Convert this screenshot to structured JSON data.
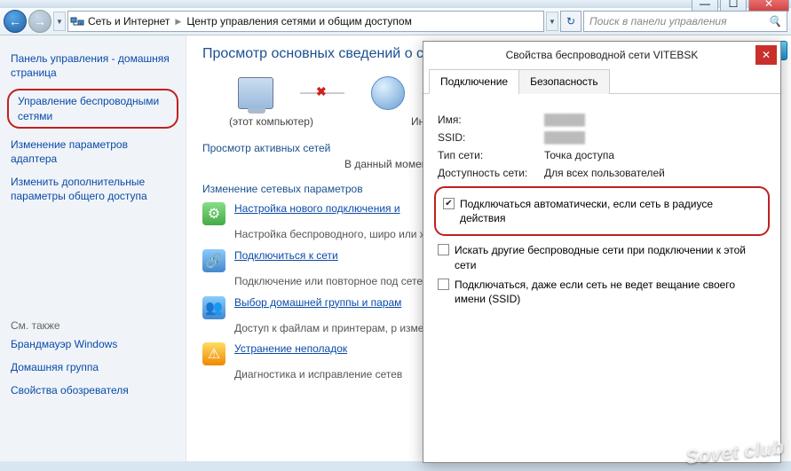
{
  "window": {
    "min": "—",
    "max": "☐",
    "close": "✕"
  },
  "nav": {
    "crumb1": "Сеть и Интернет",
    "crumb2": "Центр управления сетями и общим доступом",
    "search_placeholder": "Поиск в панели управления"
  },
  "sidebar": {
    "home": "Панель управления - домашняя страница",
    "items": [
      "Управление беспроводными сетями",
      "Изменение параметров адаптера",
      "Изменить дополнительные параметры общего доступа"
    ],
    "also_header": "См. также",
    "also": [
      "Брандмауэр Windows",
      "Домашняя группа",
      "Свойства обозревателя"
    ]
  },
  "content": {
    "h1": "Просмотр основных сведений о се",
    "diag_pc": "(этот компьютер)",
    "diag_net": "Интерне",
    "active_h": "Просмотр активных сетей",
    "active_sub": "В данный момент",
    "params_h": "Изменение сетевых параметров",
    "tasks": [
      {
        "link": "Настройка нового подключения и",
        "desc": "Настройка беспроводного, широ\nили же настройка маршрутизато"
      },
      {
        "link": "Подключиться к сети",
        "desc": "Подключение или повторное под\nсетевому соединению или подкл"
      },
      {
        "link": "Выбор домашней группы и парам",
        "desc": "Доступ к файлам и принтерам, р\nизменение параметров общего д"
      },
      {
        "link": "Устранение неполадок",
        "desc": "Диагностика и исправление сетев"
      }
    ]
  },
  "dialog": {
    "title": "Свойства беспроводной сети VITEBSK",
    "tabs": [
      "Подключение",
      "Безопасность"
    ],
    "fields": {
      "name_label": "Имя:",
      "ssid_label": "SSID:",
      "type_label": "Тип сети:",
      "type_value": "Точка доступа",
      "avail_label": "Доступность сети:",
      "avail_value": "Для всех пользователей"
    },
    "checks": [
      "Подключаться автоматически, если сеть в радиусе действия",
      "Искать другие беспроводные сети при подключении к этой сети",
      "Подключаться, даже если сеть не ведет вещание своего имени (SSID)"
    ]
  },
  "watermark": "Sovet club"
}
